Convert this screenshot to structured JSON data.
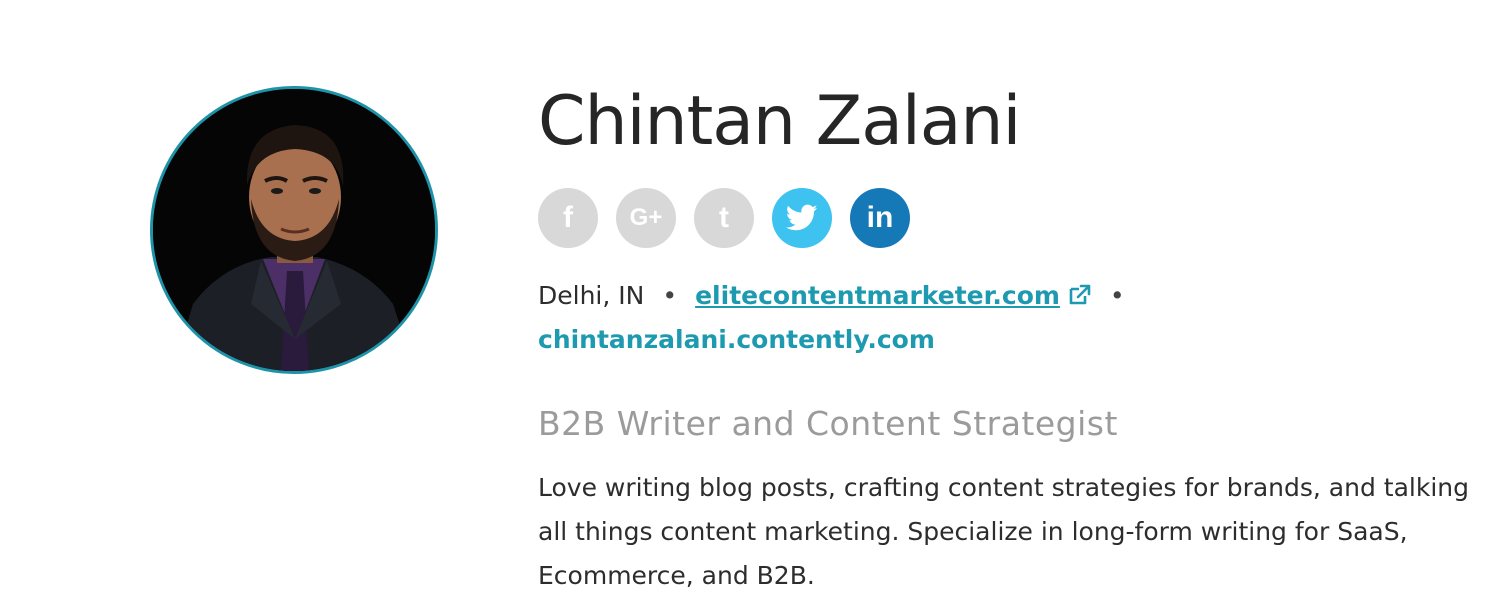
{
  "profile": {
    "name": "Chintan Zalani",
    "location": "Delhi, IN",
    "separator": "•",
    "website": "elitecontentmarketer.com",
    "portfolio": "chintanzalani.contently.com",
    "tagline": "B2B Writer and Content Strategist",
    "bio": "Love writing blog posts, crafting content strategies for brands, and talking all things content marketing. Specialize in long-form writing for SaaS, Ecommerce, and B2B."
  },
  "social": [
    {
      "network": "facebook",
      "icon": "facebook-icon",
      "glyph": "f",
      "active": false,
      "color": "#d8d8d8"
    },
    {
      "network": "google-plus",
      "icon": "google-plus-icon",
      "glyph": "G+",
      "active": false,
      "color": "#d8d8d8"
    },
    {
      "network": "tumblr",
      "icon": "tumblr-icon",
      "glyph": "t",
      "active": false,
      "color": "#d8d8d8"
    },
    {
      "network": "twitter",
      "icon": "twitter-icon",
      "glyph": "bird",
      "active": true,
      "color": "#3ec3f0"
    },
    {
      "network": "linkedin",
      "icon": "linkedin-icon",
      "glyph": "in",
      "active": true,
      "color": "#1579b8"
    }
  ],
  "colors": {
    "accent": "#1e9ab0",
    "avatar_ring": "#1e93a8",
    "tagline": "#9b9b9b",
    "text": "#2d2d2d"
  },
  "icons": {
    "external_link": "external-link-icon"
  }
}
